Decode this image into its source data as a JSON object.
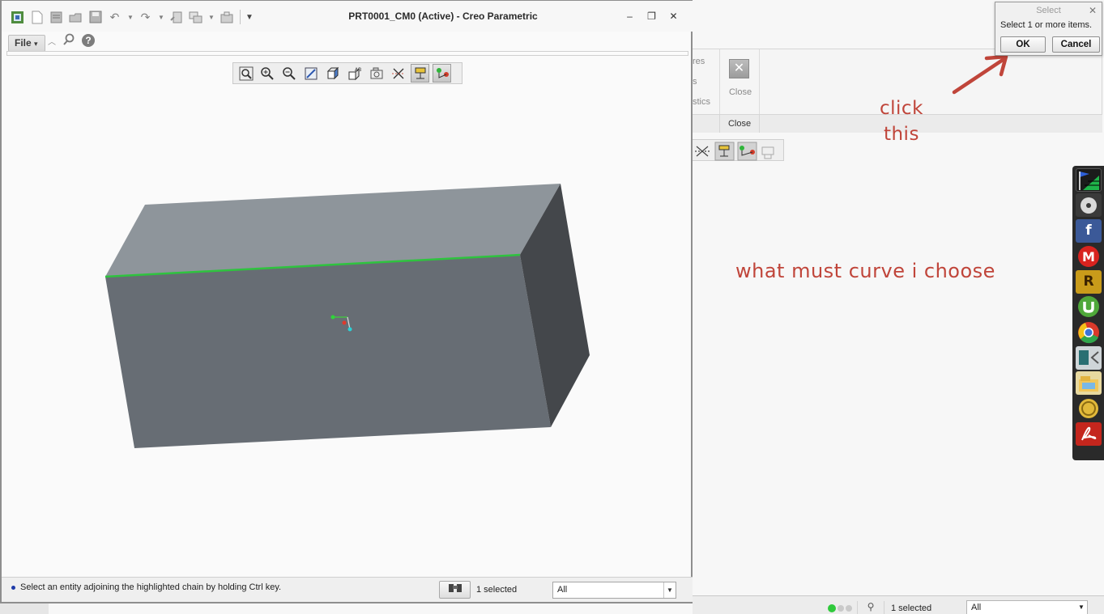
{
  "window": {
    "title": "PRT0001_CM0 (Active) - Creo Parametric"
  },
  "menu": {
    "file_label": "File",
    "file_arrow": "▾",
    "help_label": "?"
  },
  "status": {
    "message": "Select an entity adjoining the highlighted chain by holding Ctrl key.",
    "selected_count": "1 selected",
    "filter_value": "All"
  },
  "background": {
    "ribbon_cut_labels": [
      "res",
      "s",
      "stics"
    ],
    "close_button_label": "Close",
    "close_group_label": "Close",
    "selected_count": "1 selected",
    "filter_value": "All"
  },
  "select_dialog": {
    "title": "Select",
    "message": "Select 1 or more items.",
    "ok_label": "OK",
    "cancel_label": "Cancel"
  },
  "annotations": {
    "click_line1": "click",
    "click_line2": "this",
    "question": "what must curve i choose",
    "color": "#c0453a"
  },
  "colors": {
    "highlight_edge": "#2fc33f",
    "model_top": "#8e959b",
    "model_front": "#676d74",
    "model_side": "#44474b"
  },
  "launch_bar": {
    "icons": [
      "flag-app-icon",
      "disc-icon",
      "facebook-icon",
      "gmail-icon",
      "r-app-icon",
      "utorrent-icon",
      "chrome-icon",
      "folder-arrow-icon",
      "explorer-icon",
      "coins-icon",
      "acrobat-icon"
    ]
  }
}
